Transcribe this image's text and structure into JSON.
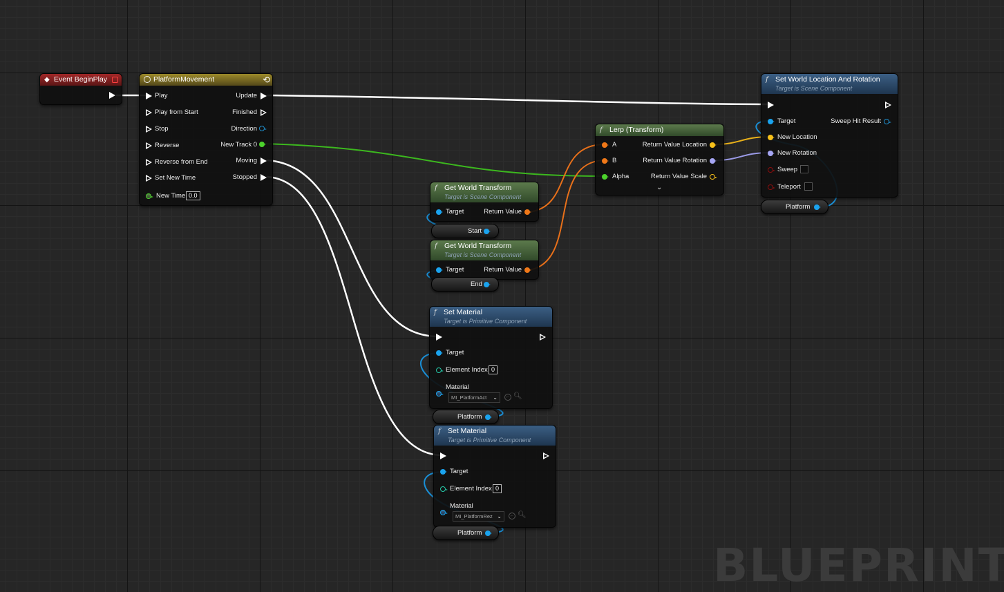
{
  "watermark": "BLUEPRINT",
  "colors": {
    "exec": "#ffffff",
    "object": "#1aa3ee",
    "transform": "#f07818",
    "vector": "#f7c11a",
    "rotator": "#a6a6f4",
    "float": "#4cd22c",
    "int": "#25c8a8",
    "bool": "#8a0e0e"
  },
  "event_begin_play": {
    "title": "Event BeginPlay"
  },
  "timeline": {
    "title": "PlatformMovement",
    "inputs": [
      "Play",
      "Play from Start",
      "Stop",
      "Reverse",
      "Reverse from End",
      "Set New Time"
    ],
    "new_time_label": "New Time",
    "new_time_value": "0.0",
    "outputs": [
      "Update",
      "Finished",
      "Direction",
      "New Track 0",
      "Moving",
      "Stopped"
    ]
  },
  "get_world_transform_1": {
    "title": "Get World Transform",
    "subtitle": "Target is Scene Component",
    "target": "Target",
    "return": "Return Value"
  },
  "get_world_transform_2": {
    "title": "Get World Transform",
    "subtitle": "Target is Scene Component",
    "target": "Target",
    "return": "Return Value"
  },
  "var_start": {
    "label": "Start"
  },
  "var_end": {
    "label": "End"
  },
  "lerp": {
    "title": "Lerp (Transform)",
    "a": "A",
    "b": "B",
    "alpha": "Alpha",
    "out_location": "Return Value Location",
    "out_rotation": "Return Value Rotation",
    "out_scale": "Return Value Scale"
  },
  "set_world": {
    "title": "Set World Location And Rotation",
    "subtitle": "Target is Scene Component",
    "target": "Target",
    "new_location": "New Location",
    "new_rotation": "New Rotation",
    "sweep": "Sweep",
    "teleport": "Teleport",
    "sweep_hit": "Sweep Hit Result"
  },
  "var_platform_1": {
    "label": "Platform"
  },
  "set_material_1": {
    "title": "Set Material",
    "subtitle": "Target is Primitive Component",
    "target": "Target",
    "element_index": "Element Index",
    "index_value": "0",
    "material": "Material",
    "material_value": "MI_PlatformAct"
  },
  "var_platform_2": {
    "label": "Platform"
  },
  "set_material_2": {
    "title": "Set Material",
    "subtitle": "Target is Primitive Component",
    "target": "Target",
    "element_index": "Element Index",
    "index_value": "0",
    "material": "Material",
    "material_value": "MI_PlatformRez"
  },
  "var_platform_3": {
    "label": "Platform"
  }
}
